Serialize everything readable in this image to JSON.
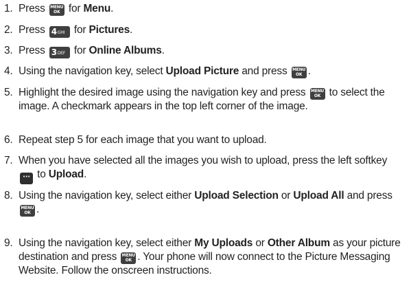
{
  "steps": [
    {
      "num": "1.",
      "pre": "Press",
      "post": "for",
      "bold": "Menu",
      "end": "."
    },
    {
      "num": "2.",
      "pre": "Press",
      "key_label": "4",
      "key_sub": "GHI",
      "post": "for",
      "bold": "Pictures",
      "end": "."
    },
    {
      "num": "3.",
      "pre": "Press",
      "key_label": "3",
      "key_sub": "DEF",
      "post": "for",
      "bold": "Online Albums",
      "end": "."
    },
    {
      "num": "4.",
      "pre": "Using the navigation key, select",
      "bold": "Upload Picture",
      "post": "and press",
      "end": "."
    },
    {
      "num": "5.",
      "pre": "Highlight the desired image using the navigation key and press",
      "post": "to select the image. A checkmark appears in the top left corner of the image."
    },
    {
      "num": "6.",
      "text": "Repeat step 5 for each image that you want to upload."
    },
    {
      "num": "7.",
      "pre": "When you have selected all the images you wish to upload, press the left softkey",
      "post": "to",
      "bold": "Upload",
      "end": "."
    },
    {
      "num": "8.",
      "pre": "Using the navigation key, select either",
      "bold1": "Upload Selection",
      "mid": "or",
      "bold2": "Upload All",
      "post": "and press",
      "end": "."
    },
    {
      "num": "9.",
      "pre": "Using the navigation key, select either",
      "bold1": "My Uploads",
      "mid": "or",
      "bold2": "Other Album",
      "post": "as your picture destination and press",
      "end": ". Your phone will now connect to the Picture Messaging Website. Follow the onscreen instructions."
    }
  ],
  "keys": {
    "menu_top": "MENU",
    "menu_bottom": "OK",
    "softkey": "···"
  }
}
